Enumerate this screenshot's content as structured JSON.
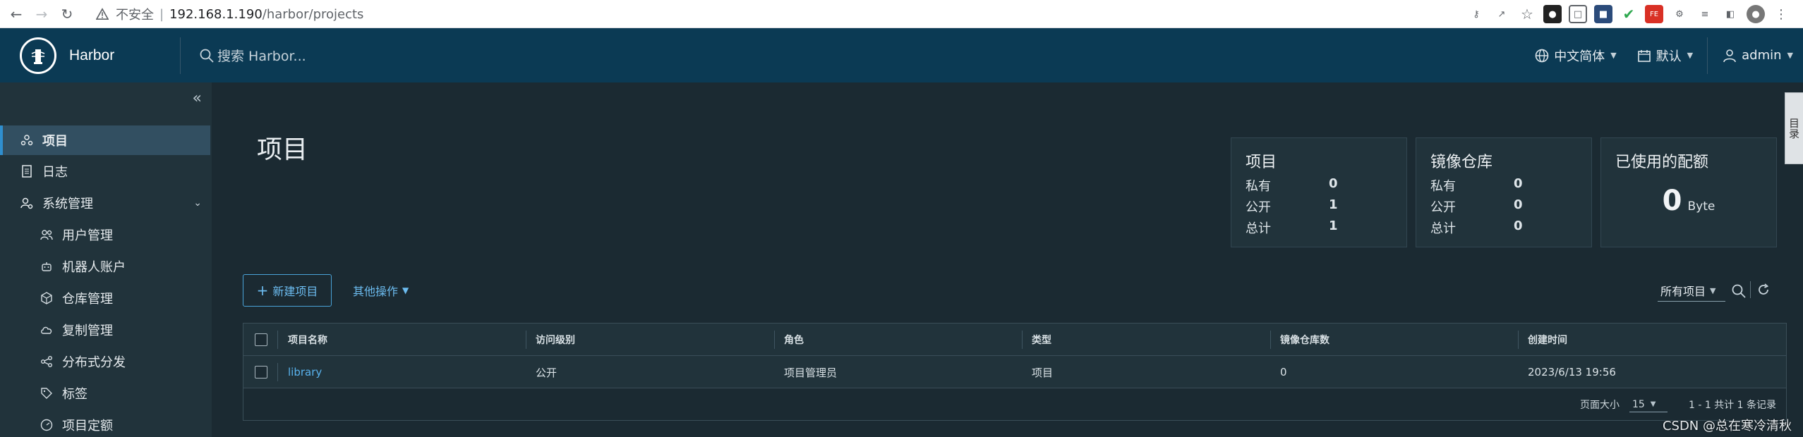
{
  "browser": {
    "insecure_label": "不安全",
    "url_host": "192.168.1.190",
    "url_path": "/harbor/projects"
  },
  "header": {
    "brand": "Harbor",
    "search_placeholder": "搜索 Harbor...",
    "language": "中文简体",
    "theme": "默认",
    "user": "admin"
  },
  "sidebar": {
    "items": [
      {
        "label": "项目",
        "icon": "projects-icon",
        "active": true
      },
      {
        "label": "日志",
        "icon": "logs-icon"
      },
      {
        "label": "系统管理",
        "icon": "admin-icon",
        "expanded": true
      },
      {
        "label": "用户管理",
        "icon": "users-icon"
      },
      {
        "label": "机器人账户",
        "icon": "robot-icon"
      },
      {
        "label": "仓库管理",
        "icon": "registry-icon"
      },
      {
        "label": "复制管理",
        "icon": "replication-icon"
      },
      {
        "label": "分布式分发",
        "icon": "share-icon"
      },
      {
        "label": "标签",
        "icon": "tag-icon"
      },
      {
        "label": "项目定额",
        "icon": "quota-icon"
      }
    ]
  },
  "main": {
    "title": "项目",
    "cards": {
      "projects": {
        "title": "项目",
        "private_label": "私有",
        "private": "0",
        "public_label": "公开",
        "public": "1",
        "total_label": "总计",
        "total": "1"
      },
      "repos": {
        "title": "镜像仓库",
        "private_label": "私有",
        "private": "0",
        "public_label": "公开",
        "public": "0",
        "total_label": "总计",
        "total": "0"
      },
      "quota": {
        "title": "已使用的配额",
        "value": "0",
        "unit": "Byte"
      }
    },
    "new_project_label": "新建项目",
    "more_actions_label": "其他操作",
    "filter_label": "所有项目",
    "table": {
      "headers": [
        "项目名称",
        "访问级别",
        "角色",
        "类型",
        "镜像仓库数",
        "创建时间"
      ],
      "rows": [
        {
          "name": "library",
          "access": "公开",
          "role": "项目管理员",
          "type": "项目",
          "repo_count": "0",
          "created": "2023/6/13 19:56"
        }
      ],
      "page_size_label": "页面大小",
      "page_size": "15",
      "count_label": "1 - 1 共计 1 条记录"
    }
  },
  "side_tab_label": "目录",
  "watermark": "CSDN @总在寒冷清秋",
  "colors": {
    "accent": "#59b3ee",
    "header_bg": "#0b3a54",
    "sidebar_bg": "#21333b",
    "main_bg": "#1b2a32"
  }
}
